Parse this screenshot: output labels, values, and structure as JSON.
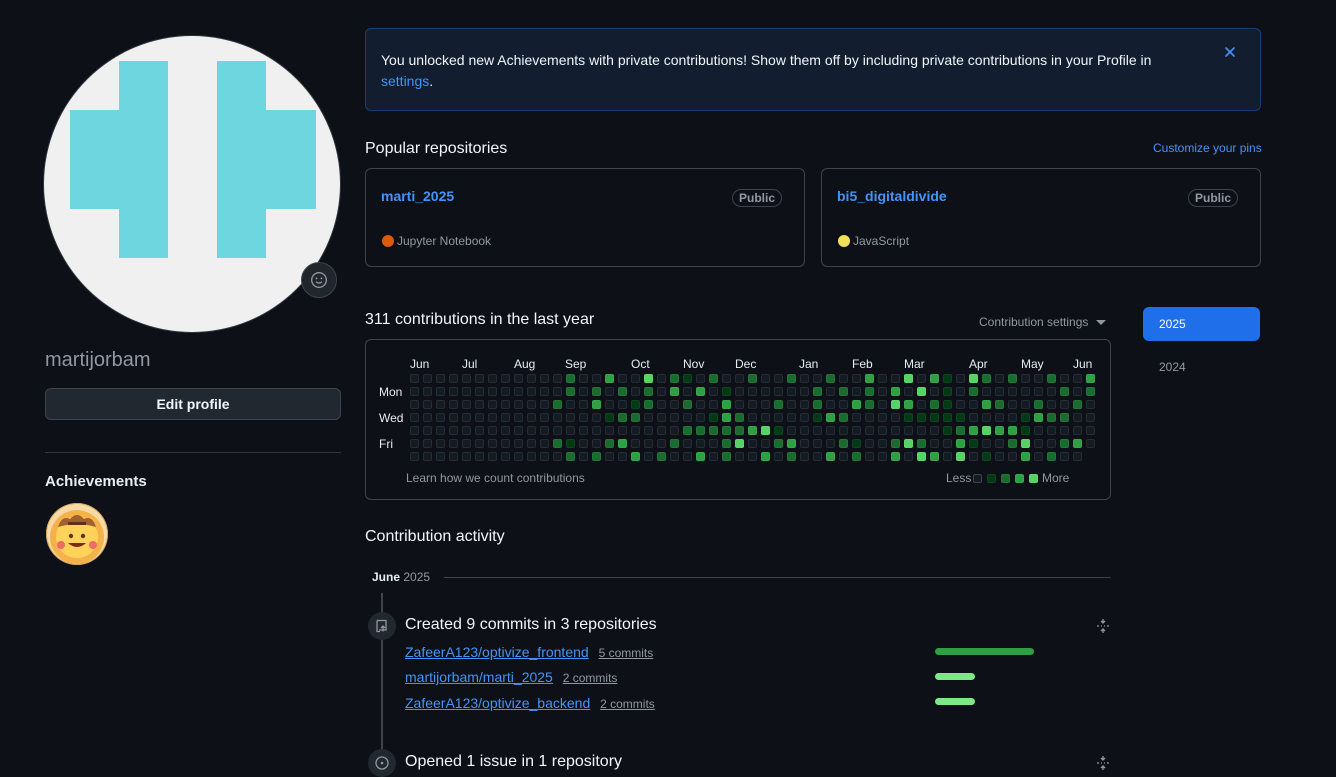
{
  "profile": {
    "username": "martijorbam",
    "edit_profile_label": "Edit profile",
    "achievements_title": "Achievements"
  },
  "banner": {
    "text": "You unlocked new Achievements with private contributions! Show them off by including private contributions in your Profile in ",
    "link": "settings",
    "end": "."
  },
  "popular": {
    "title": "Popular repositories",
    "customize_label": "Customize your pins",
    "repos": [
      {
        "name": "marti_2025",
        "visibility": "Public",
        "language": "Jupyter Notebook",
        "language_color": "#DA5B0B"
      },
      {
        "name": "bi5_digitaldivide",
        "visibility": "Public",
        "language": "JavaScript",
        "language_color": "#f1e05a"
      }
    ]
  },
  "contributions": {
    "title": "311 contributions in the last year",
    "settings_label": "Contribution settings",
    "months": [
      "Jun",
      "Jul",
      "Aug",
      "Sep",
      "Oct",
      "Nov",
      "Dec",
      "Jan",
      "Feb",
      "Mar",
      "Apr",
      "May",
      "Jun"
    ],
    "day_labels": [
      "Mon",
      "Wed",
      "Fri"
    ],
    "learn_label": "Learn how we count contributions",
    "legend_less": "Less",
    "legend_more": "More",
    "level_colors": [
      "#151b23",
      "#033a16",
      "#196c2e",
      "#2ea043",
      "#56d364"
    ]
  },
  "years": [
    "2025",
    "2024"
  ],
  "activity": {
    "title": "Contribution activity",
    "month": "June",
    "year": "2025",
    "commits_title": "Created 9 commits in 3 repositories",
    "commit_repos": [
      {
        "repo": "ZafeerA123/optivize_frontend",
        "count": "5 commits",
        "commits": 5
      },
      {
        "repo": "martijorbam/marti_2025",
        "count": "2 commits",
        "commits": 2
      },
      {
        "repo": "ZafeerA123/optivize_backend",
        "count": "2 commits",
        "commits": 2
      }
    ],
    "issue_title": "Opened 1 issue in 1 repository"
  }
}
